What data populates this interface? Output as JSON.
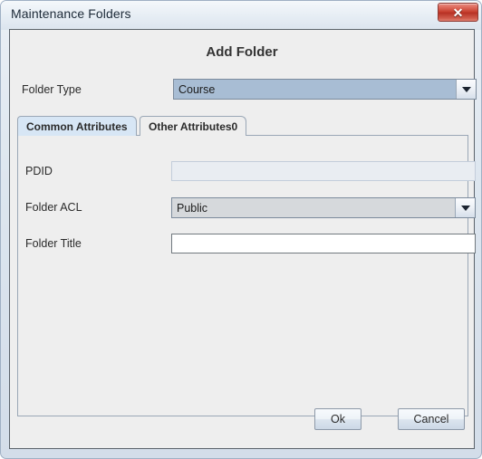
{
  "window": {
    "title": "Maintenance Folders",
    "close_label": "✕",
    "close_icon": "close-icon"
  },
  "form": {
    "heading": "Add Folder",
    "folder_type": {
      "label": "Folder Type",
      "value": "Course",
      "arrow_icon": "chevron-down-icon"
    }
  },
  "tabs": [
    {
      "label": "Common Attributes",
      "active": true
    },
    {
      "label": "Other Attributes0",
      "active": false
    }
  ],
  "fields": {
    "pdid": {
      "label": "PDID",
      "value": "",
      "placeholder": "",
      "enabled": false
    },
    "folder_acl": {
      "label": "Folder ACL",
      "value": "Public",
      "arrow_icon": "chevron-down-icon"
    },
    "folder_title": {
      "label": "Folder Title",
      "value": "",
      "placeholder": "",
      "enabled": true
    }
  },
  "buttons": {
    "ok": "Ok",
    "cancel": "Cancel"
  },
  "colors": {
    "titlebar_start": "#f4f8fb",
    "titlebar_end": "#dbe4ee",
    "close_red": "#c63c2c",
    "panel_bg": "#eeeeee",
    "active_tab_bg": "#d7e6f5",
    "combo_selected_bg": "#a8bdd4",
    "combo_bg": "#d6d9dc",
    "disabled_field_bg": "#e9edf2"
  }
}
